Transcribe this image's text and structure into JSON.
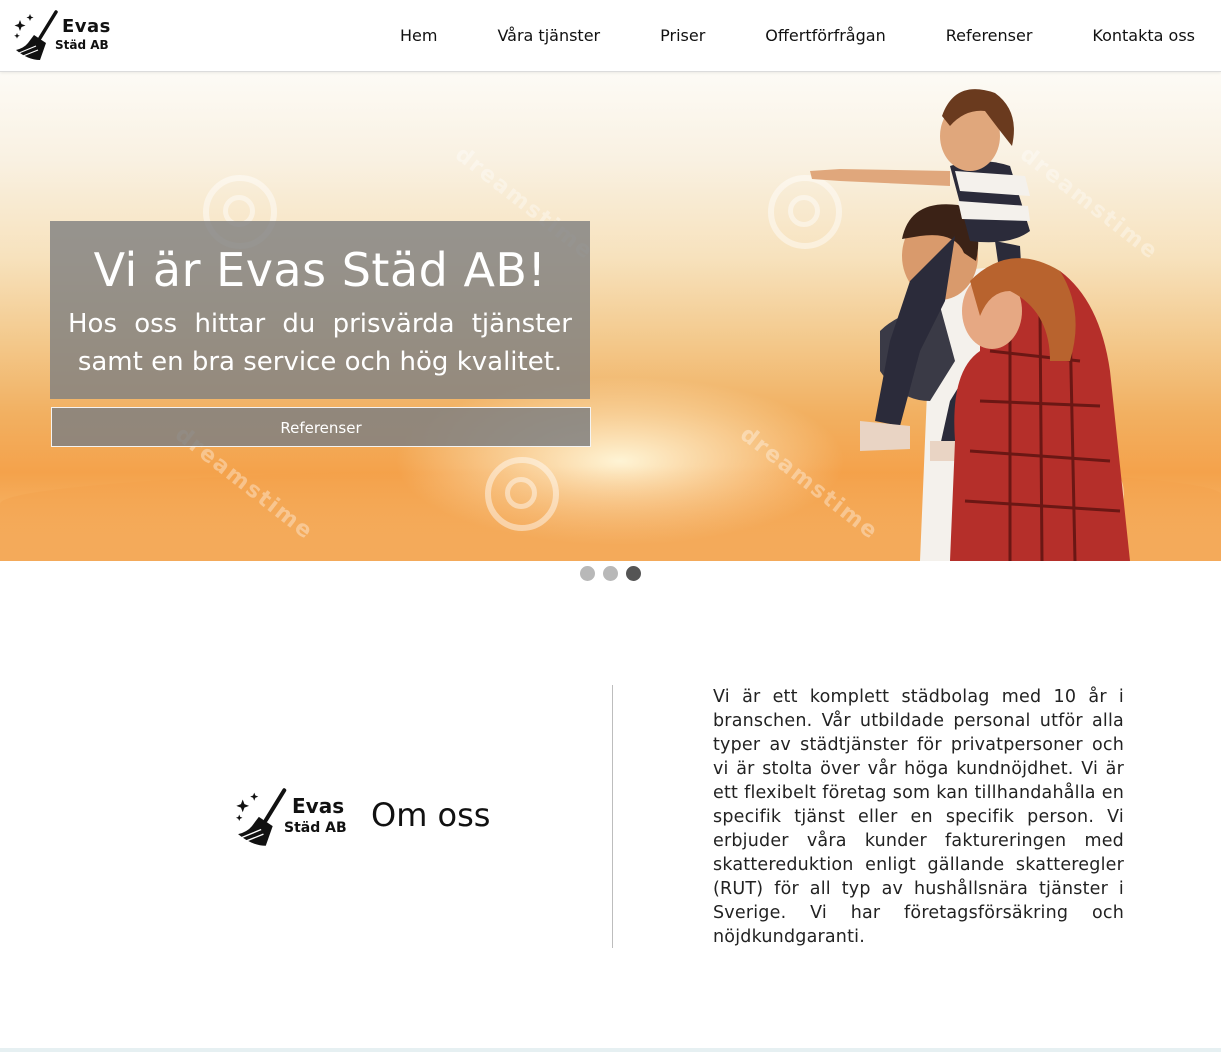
{
  "brand": {
    "name_line1": "Evas",
    "name_line2": "Städ AB"
  },
  "nav": {
    "items": [
      {
        "label": "Hem"
      },
      {
        "label": "Våra tjänster"
      },
      {
        "label": "Priser"
      },
      {
        "label": "Offertförfrågan"
      },
      {
        "label": "Referenser"
      },
      {
        "label": "Kontakta oss"
      }
    ]
  },
  "hero": {
    "title": "Vi är Evas Städ AB!",
    "subtitle": "Hos oss hittar du prisvärda tjänster samt en bra service och hög kvalitet.",
    "button_label": "Referenser",
    "watermark_text": "dreamstime",
    "overlay_color": "#808080"
  },
  "carousel": {
    "slide_count": 3,
    "active_index": 2,
    "dot_color": "#b8b8b8",
    "active_dot_color": "#555555"
  },
  "about": {
    "title": "Om oss",
    "text": "Vi är ett komplett städbolag med 10 år i branschen. Vår utbildade personal utför alla typer av städtjänster för privatpersoner och vi är stolta över vår höga kundnöjdhet. Vi är ett flexibelt företag som kan tillhandahålla en specifik tjänst eller en specifik person. Vi erbjuder våra kunder faktureringen med skattereduktion enligt gällande skatteregler (RUT) för all typ av hushållsnära tjänster i Sverige. Vi har företagsförsäkring och nöjdkundgaranti."
  },
  "icons": {
    "logo": "broom-icon",
    "sparkle": "sparkle-icon"
  }
}
